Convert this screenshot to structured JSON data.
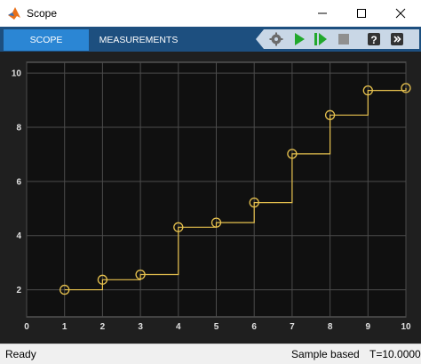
{
  "window": {
    "title": "Scope"
  },
  "toolstrip": {
    "tabs": [
      {
        "label": "SCOPE",
        "active": true
      },
      {
        "label": "MEASUREMENTS",
        "active": false
      }
    ],
    "tools": [
      "settings-icon",
      "run-icon",
      "step-forward-icon",
      "stop-icon",
      "help-icon",
      "more-icon"
    ]
  },
  "status": {
    "ready": "Ready",
    "mode": "Sample based",
    "time": "T=10.0000"
  },
  "colors": {
    "plot_background": "#101010",
    "trace": "#e6c14e",
    "grid": "#4b4b4b",
    "tab_active": "#2b86d4",
    "toolstrip": "#1d4f7f"
  },
  "chart_data": {
    "type": "line",
    "style": "step with circle markers",
    "x": [
      1,
      2,
      3,
      4,
      5,
      6,
      7,
      8,
      9,
      10
    ],
    "y": [
      2.0,
      2.37,
      2.56,
      4.31,
      4.48,
      5.22,
      7.02,
      8.45,
      9.36,
      9.45
    ],
    "xlim": [
      0,
      10
    ],
    "ylim": [
      1,
      10.4
    ],
    "xticks": [
      "0",
      "1",
      "2",
      "3",
      "4",
      "5",
      "6",
      "7",
      "8",
      "9",
      "10"
    ],
    "yticks": [
      "2",
      "4",
      "6",
      "8",
      "10"
    ],
    "grid": true
  }
}
